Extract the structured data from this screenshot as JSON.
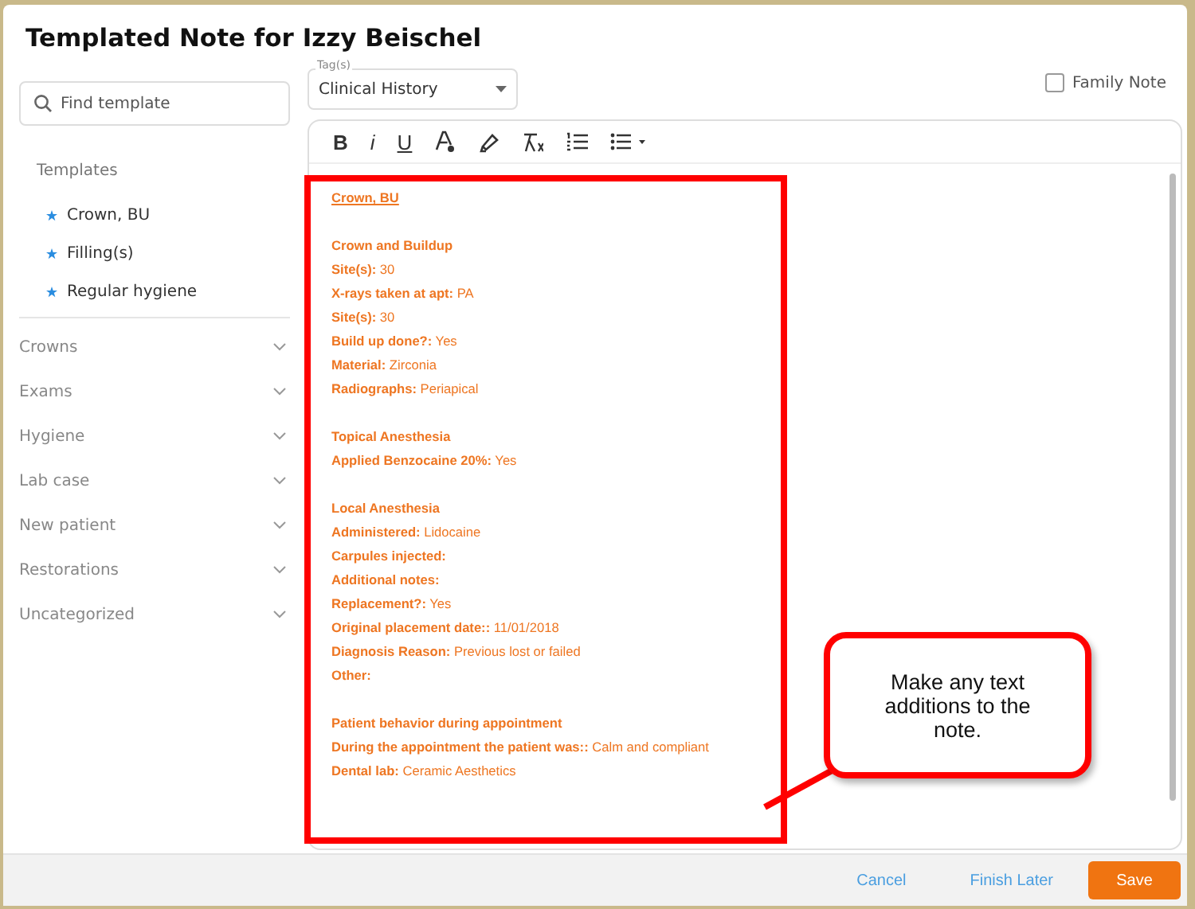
{
  "dialog": {
    "title": "Templated Note for Izzy Beischel"
  },
  "search": {
    "placeholder": "Find template"
  },
  "tags": {
    "label": "Tag(s)",
    "value": "Clinical History"
  },
  "family_note": {
    "label": "Family Note",
    "checked": false
  },
  "toolbar": [
    {
      "kind": "bold",
      "label": "B"
    },
    {
      "kind": "italic",
      "label": "i"
    },
    {
      "kind": "underline",
      "label": "U"
    },
    {
      "kind": "font-color"
    },
    {
      "kind": "highlight"
    },
    {
      "kind": "clear-format"
    },
    {
      "kind": "numbered-list"
    },
    {
      "kind": "bullet-list"
    }
  ],
  "templates": {
    "heading": "Templates",
    "items": [
      "Crown, BU",
      "Filling(s)",
      "Regular hygiene"
    ]
  },
  "categories": [
    {
      "label": "Crowns",
      "expanded": false
    },
    {
      "label": "Exams",
      "expanded": false
    },
    {
      "label": "Hygiene",
      "expanded": false
    },
    {
      "label": "Lab case",
      "expanded": false
    },
    {
      "label": "New patient",
      "expanded": false
    },
    {
      "label": "Restorations",
      "expanded": false
    },
    {
      "label": "Uncategorized",
      "expanded": false
    }
  ],
  "note": {
    "title": "Crown, BU",
    "sections": [
      {
        "heading": "Crown and Buildup",
        "fields": [
          {
            "label": "Site(s):",
            "value": "30"
          },
          {
            "label": "X-rays taken at apt:",
            "value": "PA"
          },
          {
            "label": "Site(s):",
            "value": "30"
          },
          {
            "label": "Build up done?:",
            "value": "Yes"
          },
          {
            "label": "Material:",
            "value": "Zirconia"
          },
          {
            "label": "Radiographs:",
            "value": "Periapical"
          }
        ]
      },
      {
        "heading": "Topical Anesthesia",
        "fields": [
          {
            "label": "Applied Benzocaine 20%:",
            "value": "Yes"
          }
        ]
      },
      {
        "heading": "Local Anesthesia",
        "fields": [
          {
            "label": "Administered:",
            "value": "Lidocaine"
          },
          {
            "label": "Carpules injected:"
          },
          {
            "label": "Additional notes:"
          },
          {
            "label": "Replacement?:",
            "value": "Yes"
          },
          {
            "label": "Original placement date::",
            "value": "11/01/2018"
          },
          {
            "label": "Diagnosis Reason:",
            "value": "Previous lost or failed"
          },
          {
            "label": "Other:"
          }
        ]
      },
      {
        "heading": "Patient behavior during appointment",
        "fields": [
          {
            "label": "During the appointment the patient was::",
            "value": "Calm and compliant"
          },
          {
            "label": "Dental lab:",
            "value": "Ceramic Aesthetics"
          }
        ]
      }
    ]
  },
  "callout": {
    "text": "Make any text additions to the note."
  },
  "footer": {
    "buttons": [
      {
        "label": "Cancel",
        "kind": "link"
      },
      {
        "label": "Finish Later",
        "kind": "link"
      },
      {
        "label": "Save",
        "kind": "primary"
      }
    ]
  }
}
